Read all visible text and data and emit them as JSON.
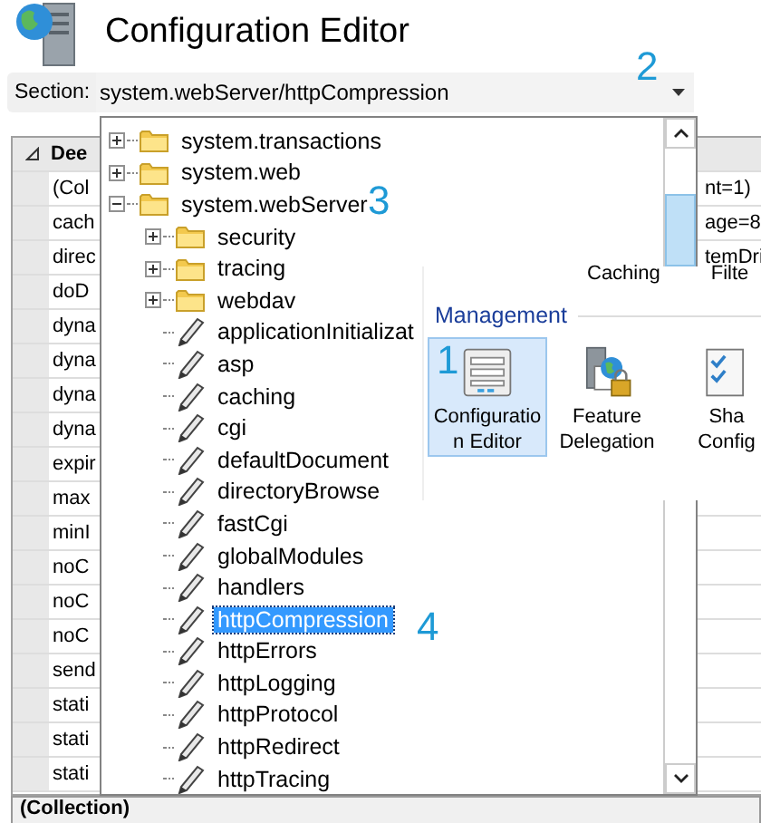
{
  "header": {
    "title": "Configuration Editor"
  },
  "section": {
    "label": "Section:",
    "value": "system.webServer/httpCompression"
  },
  "grid": {
    "rows": [
      {
        "kind": "group",
        "name": "Dee",
        "expanded": true
      },
      {
        "kind": "property",
        "name": "(Col",
        "value": "nt=1)"
      },
      {
        "kind": "property",
        "name": "cach",
        "value": "age=8"
      },
      {
        "kind": "property",
        "name": "direc",
        "value": "temDri"
      },
      {
        "kind": "property",
        "name": "doD"
      },
      {
        "kind": "property",
        "name": "dyna"
      },
      {
        "kind": "property",
        "name": "dyna"
      },
      {
        "kind": "property",
        "name": "dyna"
      },
      {
        "kind": "property",
        "name": "dyna"
      },
      {
        "kind": "property",
        "name": "expir"
      },
      {
        "kind": "property",
        "name": "max"
      },
      {
        "kind": "property",
        "name": "minI"
      },
      {
        "kind": "property",
        "name": "noC"
      },
      {
        "kind": "property",
        "name": "noC"
      },
      {
        "kind": "property",
        "name": "noC"
      },
      {
        "kind": "property",
        "name": "send"
      },
      {
        "kind": "property",
        "name": "stati"
      },
      {
        "kind": "property",
        "name": "stati"
      },
      {
        "kind": "property",
        "name": "stati"
      }
    ]
  },
  "dropdown": {
    "tree": [
      {
        "kind": "group",
        "label": "system.transactions",
        "expanded": false,
        "selected": false
      },
      {
        "kind": "group",
        "label": "system.web",
        "expanded": false,
        "selected": false
      },
      {
        "kind": "group",
        "label": "system.webServer",
        "expanded": true,
        "selected": false,
        "children": [
          {
            "kind": "group",
            "label": "security",
            "expanded": false,
            "selected": false
          },
          {
            "kind": "group",
            "label": "tracing",
            "expanded": false,
            "selected": false
          },
          {
            "kind": "group",
            "label": "webdav",
            "expanded": false,
            "selected": false
          },
          {
            "kind": "section",
            "label": "applicationInitializat",
            "selected": false
          },
          {
            "kind": "section",
            "label": "asp",
            "selected": false
          },
          {
            "kind": "section",
            "label": "caching",
            "selected": false
          },
          {
            "kind": "section",
            "label": "cgi",
            "selected": false
          },
          {
            "kind": "section",
            "label": "defaultDocument",
            "selected": false
          },
          {
            "kind": "section",
            "label": "directoryBrowse",
            "selected": false
          },
          {
            "kind": "section",
            "label": "fastCgi",
            "selected": false
          },
          {
            "kind": "section",
            "label": "globalModules",
            "selected": false
          },
          {
            "kind": "section",
            "label": "handlers",
            "selected": false
          },
          {
            "kind": "section",
            "label": "httpCompression",
            "selected": true
          },
          {
            "kind": "section",
            "label": "httpErrors",
            "selected": false
          },
          {
            "kind": "section",
            "label": "httpLogging",
            "selected": false
          },
          {
            "kind": "section",
            "label": "httpProtocol",
            "selected": false
          },
          {
            "kind": "section",
            "label": "httpRedirect",
            "selected": false
          },
          {
            "kind": "section",
            "label": "httpTracing",
            "selected": false
          }
        ]
      }
    ]
  },
  "inset": {
    "cut_labels": [
      "Caching",
      "Filte"
    ],
    "heading": "Management",
    "tiles": [
      {
        "kind": "form",
        "lines": [
          "Configuratio",
          "n Editor"
        ],
        "selected": true
      },
      {
        "kind": "server-lock",
        "lines": [
          "Feature",
          "Delegation"
        ],
        "selected": false
      },
      {
        "kind": "checklist",
        "lines": [
          "Sha",
          "Config"
        ],
        "selected": false
      }
    ]
  },
  "callouts": [
    "1",
    "2",
    "3",
    "4"
  ],
  "bottom_bar": {
    "text": "(Collection)"
  }
}
